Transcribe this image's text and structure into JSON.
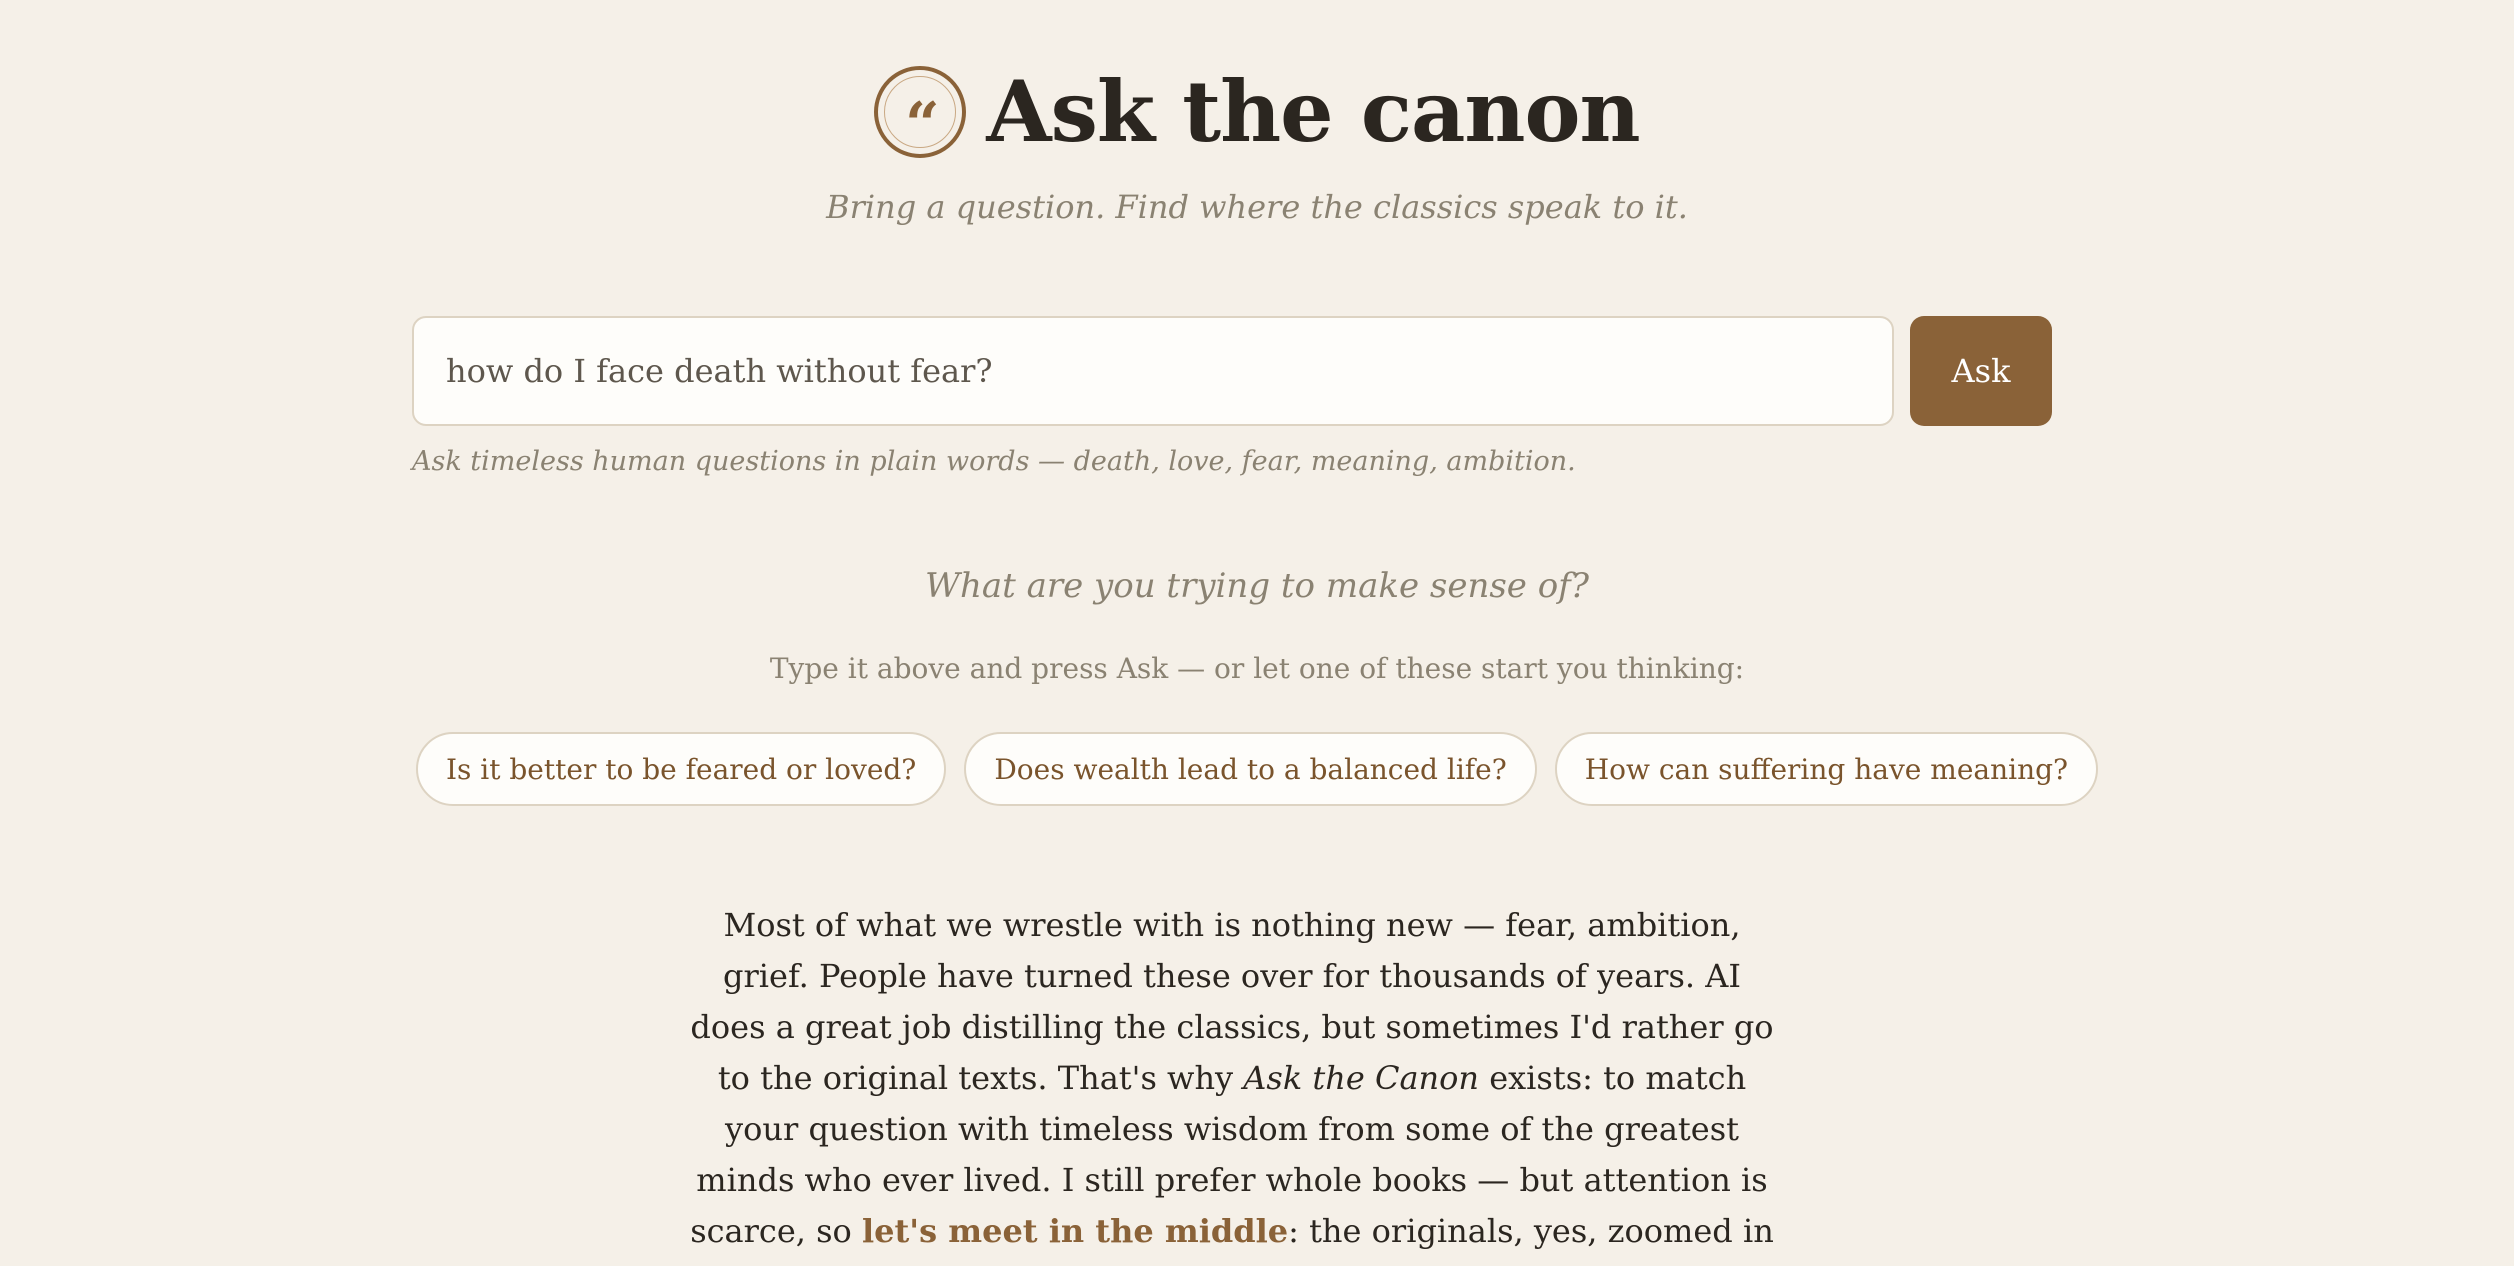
{
  "header": {
    "logo_glyph": "“",
    "title": "Ask the canon",
    "subtitle": "Bring a question. Find where the classics speak to it."
  },
  "search": {
    "value": "how do I face death without fear?",
    "placeholder": "",
    "button_label": "Ask",
    "hint": "Ask timeless human questions in plain words — death, love, fear, meaning, ambition."
  },
  "prompt": {
    "heading": "What are you trying to make sense of?",
    "subheading": "Type it above and press Ask — or let one of these start you thinking:"
  },
  "suggestions": [
    "Is it better to be feared or loved?",
    "Does wealth lead to a balanced life?",
    "How can suffering have meaning?"
  ],
  "about": {
    "part1": "Most of what we wrestle with is nothing new — fear, ambition, grief. People have turned these over for thousands of years. AI does a great job distilling the classics, but sometimes I'd rather go to the original texts. That's why ",
    "emph": "Ask the Canon",
    "part2": " exists: to match your question with timeless wisdom from some of the greatest minds who ever lived. I still prefer whole books — but attention is scarce, so ",
    "link": "let's meet in the middle",
    "part3": ": the originals, yes, zoomed in on what you want to know right now."
  },
  "colors": {
    "background": "#f5f0e8",
    "accent": "#8a6238",
    "text": "#2b2620",
    "muted": "#8a8272"
  },
  "icons": {
    "logo": "quote-icon"
  }
}
